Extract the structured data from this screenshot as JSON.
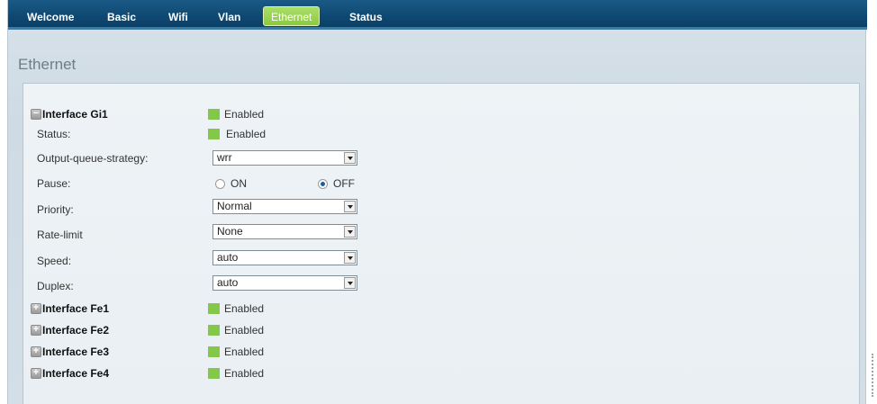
{
  "nav": {
    "items": [
      {
        "label": "Welcome"
      },
      {
        "label": "Basic"
      },
      {
        "label": "Wifi"
      },
      {
        "label": "Vlan"
      },
      {
        "label": "Ethernet",
        "active": true
      },
      {
        "label": "Status"
      }
    ]
  },
  "page": {
    "title": "Ethernet"
  },
  "gi1": {
    "name": "Interface Gi1",
    "state": "Enabled",
    "toggle": "−",
    "fields": {
      "status_label": "Status:",
      "status_value": "Enabled",
      "oqs_label": "Output-queue-strategy:",
      "oqs_value": "wrr",
      "pause_label": "Pause:",
      "pause_on": "ON",
      "pause_off": "OFF",
      "pause_selected": "OFF",
      "priority_label": "Priority:",
      "priority_value": "Normal",
      "rate_label": "Rate-limit",
      "rate_value": "None",
      "speed_label": "Speed:",
      "speed_value": "auto",
      "duplex_label": "Duplex:",
      "duplex_value": "auto"
    }
  },
  "interfaces": [
    {
      "name": "Interface Fe1",
      "state": "Enabled",
      "toggle": "+"
    },
    {
      "name": "Interface Fe2",
      "state": "Enabled",
      "toggle": "+"
    },
    {
      "name": "Interface Fe3",
      "state": "Enabled",
      "toggle": "+"
    },
    {
      "name": "Interface Fe4",
      "state": "Enabled",
      "toggle": "+"
    }
  ],
  "colors": {
    "nav_bg": "#0f4a74",
    "nav_active": "#8ccb3f",
    "status_green": "#84c84a",
    "panel_bg": "#eef3f6"
  }
}
